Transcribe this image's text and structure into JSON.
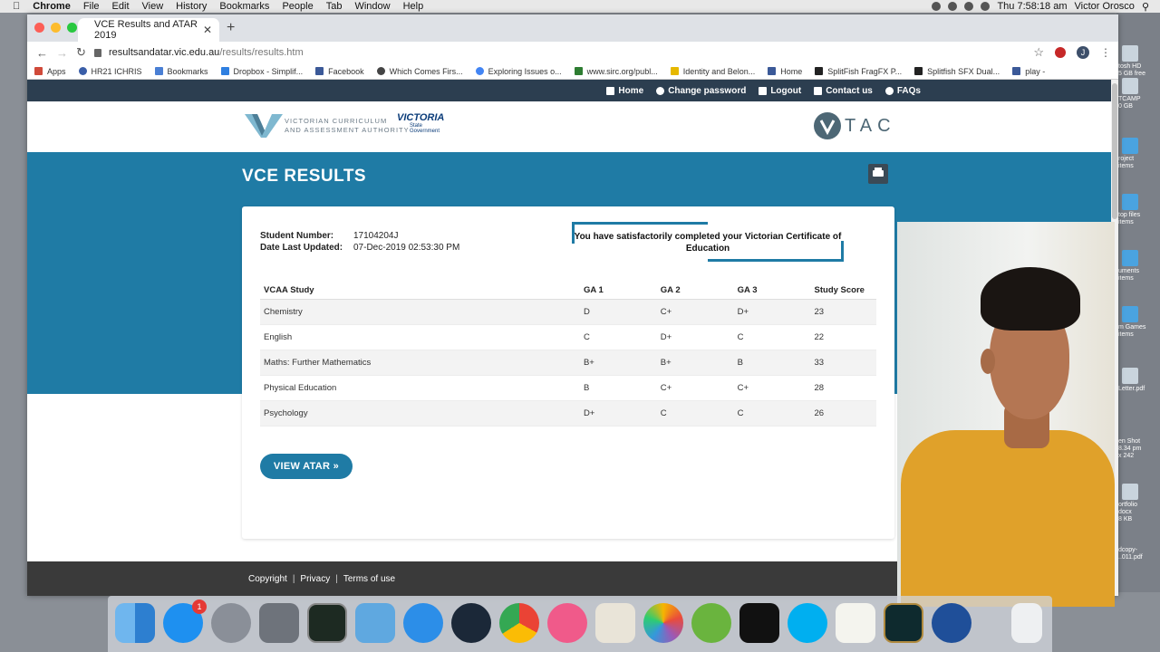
{
  "menubar": {
    "app": "Chrome",
    "items": [
      "File",
      "Edit",
      "View",
      "History",
      "Bookmarks",
      "People",
      "Tab",
      "Window",
      "Help"
    ],
    "clock": "Thu 7:58:18 am",
    "user": "Victor Orosco"
  },
  "browser": {
    "tab_title": "VCE Results and ATAR 2019",
    "url_host": "resultsandatar.vic.edu.au",
    "url_path": "/results/results.htm",
    "profile_initial": "J",
    "bookmarks": [
      "Apps",
      "HR21 ICHRIS",
      "Bookmarks",
      "Dropbox - Simplif...",
      "Facebook",
      "Which Comes Firs...",
      "Exploring Issues o...",
      "www.sirc.org/publ...",
      "Identity and Belon...",
      "Home",
      "SplitFish FragFX P...",
      "Splitfish SFX Dual...",
      "play -"
    ]
  },
  "topnav": {
    "home": "Home",
    "change_password": "Change password",
    "logout": "Logout",
    "contact": "Contact us",
    "faqs": "FAQs"
  },
  "logos": {
    "vcaa_line1": "VICTORIAN CURRICULUM",
    "vcaa_line2": "AND ASSESSMENT AUTHORITY",
    "vic_title": "VICTORIA",
    "vic_sub1": "State",
    "vic_sub2": "Government",
    "vtac": "TAC"
  },
  "page": {
    "title": "VCE RESULTS",
    "student_number_label": "Student Number:",
    "student_number": "17104204J",
    "date_label": "Date Last Updated:",
    "date_value": "07-Dec-2019 02:53:30 PM",
    "status_message": "You have satisfactorily completed your Victorian Certificate of Education",
    "table": {
      "headers": [
        "VCAA Study",
        "GA 1",
        "GA 2",
        "GA 3",
        "Study Score"
      ],
      "rows": [
        [
          "Chemistry",
          "D",
          "C+",
          "D+",
          "23"
        ],
        [
          "English",
          "C",
          "D+",
          "C",
          "22"
        ],
        [
          "Maths: Further Mathematics",
          "B+",
          "B+",
          "B",
          "33"
        ],
        [
          "Physical Education",
          "B",
          "C+",
          "C+",
          "28"
        ],
        [
          "Psychology",
          "D+",
          "C",
          "C",
          "26"
        ]
      ]
    },
    "atar_button": "VIEW ATAR »"
  },
  "footer": {
    "copyright": "Copyright",
    "privacy": "Privacy",
    "terms": "Terms of use"
  },
  "desktop": {
    "items": [
      "tosh HD",
      "5 GB free",
      "TCAMP",
      "0 GB",
      "roject",
      "items",
      "top files",
      "items",
      "uments",
      "items",
      "m Games",
      "items",
      "Letter.pdf",
      "en Shot",
      "8.34 pm",
      "x 242",
      "ortfolio",
      "docx",
      "8 KB",
      "dcopy-",
      "..011.pdf"
    ]
  },
  "dock": {
    "app_store_badge": "1"
  },
  "colors": {
    "primary": "#1f7ba5",
    "nav": "#2c3e50",
    "footer": "#3a3a3a"
  }
}
